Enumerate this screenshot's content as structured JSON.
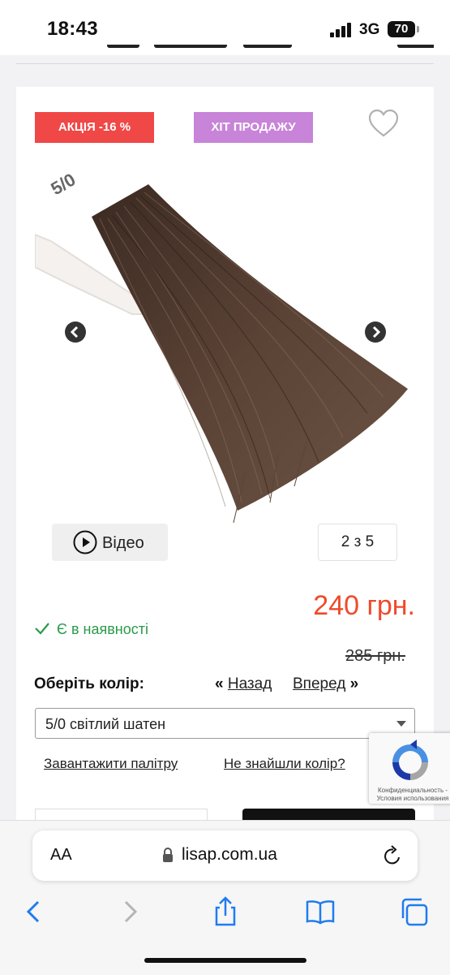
{
  "status_bar": {
    "time": "18:43",
    "network": "3G",
    "battery": "70"
  },
  "badges": {
    "sale": "АКЦІЯ -16 %",
    "hit": "ХІТ ПРОДАЖУ"
  },
  "gallery": {
    "image_label": "5/0",
    "counter": "2 з 5"
  },
  "video_button": {
    "label": "Відео"
  },
  "price": {
    "current": "240 грн.",
    "old": "285 грн."
  },
  "stock": {
    "label": "Є в наявності"
  },
  "color_select": {
    "title": "Оберіть колір:",
    "prev_label": "Назад",
    "next_label": "Вперед",
    "selected": "5/0 світлий шатен"
  },
  "links": {
    "palette": "Завантажити палітру",
    "not_found": "Не знайшли колір?"
  },
  "recaptcha": {
    "text": "Конфиденциальность - Условия использования"
  },
  "browser": {
    "aa_label": "AA",
    "url": "lisap.com.ua"
  },
  "colors": {
    "sale": "#f04747",
    "hit": "#c784d8",
    "price": "#ef4a2a",
    "stock": "#2a9a4a",
    "ios_blue": "#1f7cf0"
  },
  "icons": [
    "heart-icon",
    "prev-arrow-icon",
    "next-arrow-icon",
    "play-icon",
    "check-icon",
    "chevron-down-icon",
    "lock-icon",
    "reload-icon",
    "back-icon",
    "forward-icon",
    "share-icon",
    "bookmarks-icon",
    "tabs-icon",
    "recaptcha-logo"
  ]
}
